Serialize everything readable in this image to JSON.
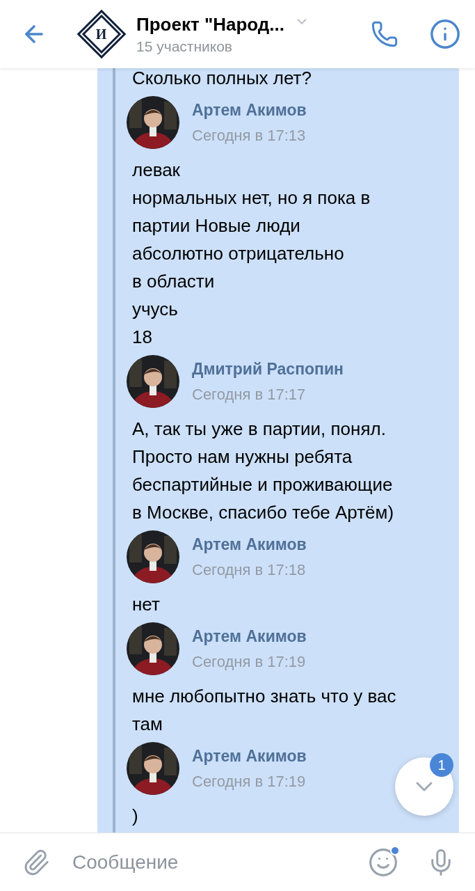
{
  "header": {
    "logo_letter": "И",
    "title": "Проект \"Народ...",
    "subtitle": "15 участников"
  },
  "forward": {
    "selected": true,
    "cut_line": "Сколько полных лет?",
    "groups": [
      {
        "author": "Артем Акимов",
        "time": "Сегодня в 17:13",
        "lines": [
          "левак",
          "нормальных нет, но я пока в",
          "партии Новые люди",
          "абсолютно отрицательно",
          "в области",
          "учусь",
          "18"
        ]
      },
      {
        "author": "Дмитрий Распопин",
        "time": "Сегодня в 17:17",
        "lines": [
          "А, так ты уже в партии, понял. Просто нам нужны ребята беспартийные и проживающие в Москве, спасибо тебе Артём)"
        ]
      },
      {
        "author": "Артем Акимов",
        "time": "Сегодня в 17:18",
        "lines": [
          "нет"
        ]
      },
      {
        "author": "Артем Акимов",
        "time": "Сегодня в 17:19",
        "lines": [
          "мне любопытно знать что у вас там"
        ]
      },
      {
        "author": "Артем Акимов",
        "time": "Сегодня в 17:19",
        "lines": [
          ")"
        ]
      }
    ]
  },
  "scroll_button": {
    "badge": "1"
  },
  "composer": {
    "placeholder": "Сообщение",
    "emoji_badge": true
  }
}
